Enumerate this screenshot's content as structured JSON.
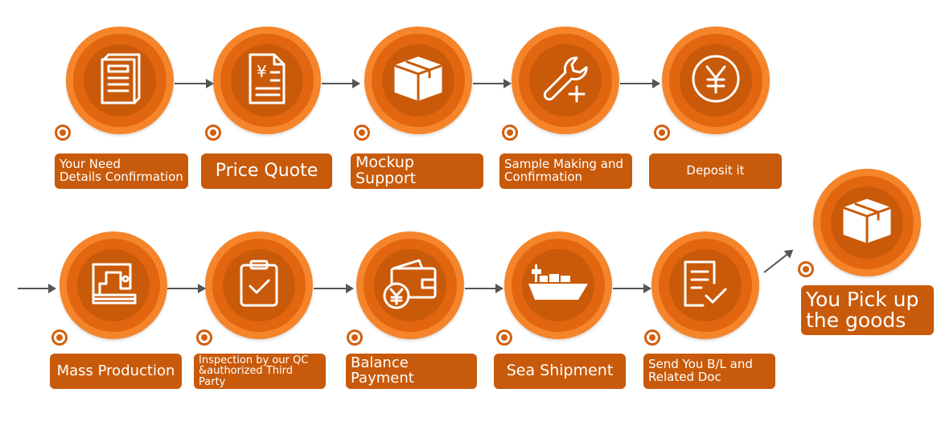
{
  "colors": {
    "outer": "#f5842a",
    "ring": "#e2660f",
    "core": "#c95a09",
    "label": "#c85a0b",
    "arrow": "#555555"
  },
  "steps": [
    {
      "label": "Your Need Details Confirmation",
      "line1": "Your Need",
      "line2": "Details Confirmation",
      "icon": "document-icon"
    },
    {
      "label": "Price Quote",
      "icon": "price-quote-icon"
    },
    {
      "label": "Mockup Support",
      "icon": "box-icon"
    },
    {
      "label": "Sample Making and Confirmation",
      "line1": "Sample Making and",
      "line2": "Confirmation",
      "icon": "wrench-plus-icon"
    },
    {
      "label": "Deposit it",
      "icon": "yen-coin-icon"
    },
    {
      "label": "Mass Production",
      "icon": "sewing-machine-icon"
    },
    {
      "label": "Inspection by our QC &authorized Third Party",
      "line1": "Inspection by our QC",
      "line2": "&authorized Third Party",
      "icon": "clipboard-check-icon"
    },
    {
      "label": "Balance Payment",
      "icon": "wallet-yen-icon"
    },
    {
      "label": "Sea Shipment",
      "icon": "ship-icon"
    },
    {
      "label": "Send You B/L and Related Doc",
      "line1": "Send You B/L and",
      "line2": "Related Doc",
      "icon": "document-check-icon"
    },
    {
      "label": "You Pick up the goods",
      "line1": "You Pick up",
      "line2": "the goods",
      "icon": "box-icon"
    }
  ]
}
